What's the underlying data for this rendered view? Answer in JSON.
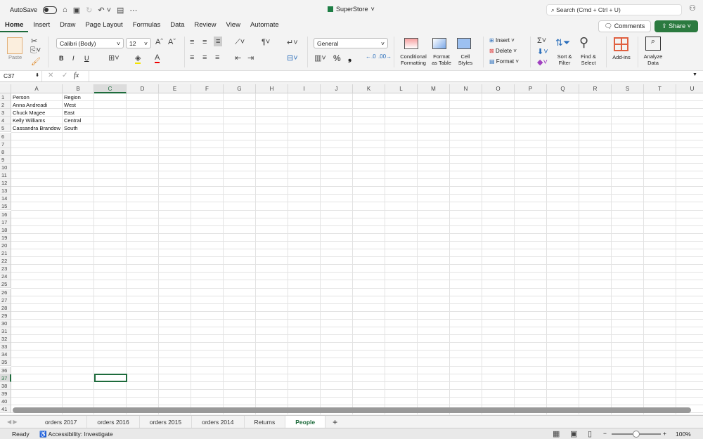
{
  "titlebar": {
    "autosave": "AutoSave",
    "file_name": "SuperStore",
    "search_placeholder": "Search (Cmd + Ctrl + U)"
  },
  "tabs": [
    "Home",
    "Insert",
    "Draw",
    "Page Layout",
    "Formulas",
    "Data",
    "Review",
    "View",
    "Automate"
  ],
  "active_tab": "Home",
  "actions": {
    "comments": "Comments",
    "share": "Share"
  },
  "ribbon": {
    "paste": "Paste",
    "font_name": "Calibri (Body)",
    "font_size": "12",
    "bold": "B",
    "italic": "I",
    "underline": "U",
    "number_format": "General",
    "percent": "%",
    "comma": "❟",
    "conditional_formatting": "Conditional Formatting",
    "format_as_table": "Format as Table",
    "cell_styles": "Cell Styles",
    "insert": "Insert",
    "delete": "Delete",
    "format": "Format",
    "sort_filter": "Sort & Filter",
    "find_select": "Find & Select",
    "add_ins": "Add-ins",
    "analyze_data": "Analyze Data"
  },
  "formula_bar": {
    "name_box": "C37",
    "fx": "fx",
    "value": ""
  },
  "columns": [
    "A",
    "B",
    "C",
    "D",
    "E",
    "F",
    "G",
    "H",
    "I",
    "J",
    "K",
    "L",
    "M",
    "N",
    "O",
    "P",
    "Q",
    "R",
    "S",
    "T",
    "U"
  ],
  "rows": 41,
  "selected_cell": "C37",
  "cells": [
    [
      "Person",
      "Region"
    ],
    [
      "Anna Andreadi",
      "West"
    ],
    [
      "Chuck Magee",
      "East"
    ],
    [
      "Kelly Williams",
      "Central"
    ],
    [
      "Cassandra Brandow",
      "South"
    ]
  ],
  "sheet_tabs": [
    "orders 2017",
    "orders 2016",
    "orders 2015",
    "orders 2014",
    "Returns",
    "People"
  ],
  "active_sheet": "People",
  "status": {
    "ready": "Ready",
    "accessibility": "Accessibility: Investigate",
    "zoom": "100%",
    "zoom_level": 1.0
  }
}
